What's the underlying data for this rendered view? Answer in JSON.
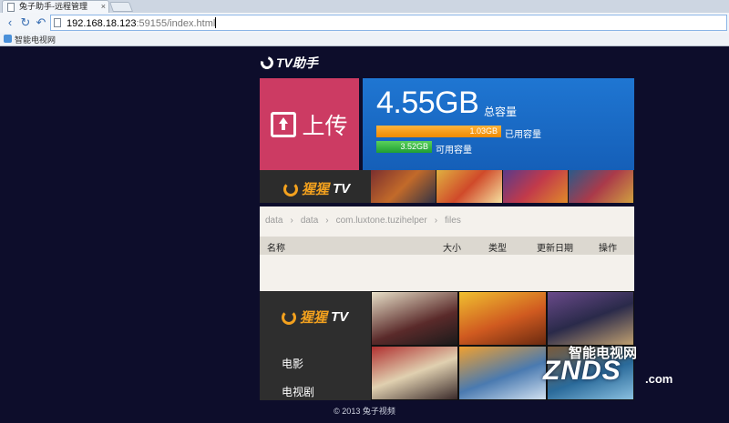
{
  "browser": {
    "tab_title": "兔子助手-远程管理",
    "url_host": "192.168.18.123",
    "url_rest": ":59155/index.html",
    "bookmark": "智能电视网"
  },
  "app": {
    "logo_text": "TV助手",
    "upload_label": "上传",
    "storage": {
      "total": "4.55GB",
      "total_label": "总容量",
      "used_value": "1.03GB",
      "used_label": "已用容量",
      "avail_value": "3.52GB",
      "avail_label": "可用容量",
      "used_fraction": 0.226,
      "avail_fraction": 0.774
    },
    "promo_logo": "TV",
    "promo_logo_prefix": "猩猩",
    "breadcrumb": [
      "data",
      "data",
      "com.luxtone.tuzihelper",
      "files"
    ],
    "columns": {
      "name": "名称",
      "size": "大小",
      "type": "类型",
      "date": "更新日期",
      "action": "操作"
    },
    "menu": [
      "电影",
      "电视剧"
    ],
    "footer": "© 2013 兔子视频"
  },
  "watermark": {
    "top": "智能电视网",
    "main": "ZNDS",
    "suffix": ".com"
  },
  "colors": {
    "upload_tile": "#cc3b63",
    "storage_tile": "#1f76d2",
    "used_bar": "#f08a00",
    "avail_bar": "#1f9e34",
    "page_bg": "#0d0d2b"
  }
}
